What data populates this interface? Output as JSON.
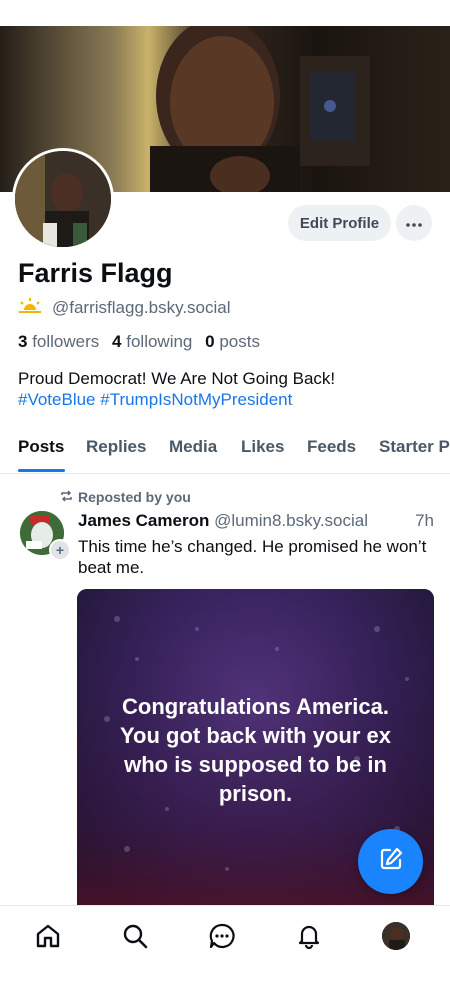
{
  "profile": {
    "display_name": "Farris Flagg",
    "handle": "@farrisflagg.bsky.social",
    "followers_count": "3",
    "followers_label": "followers",
    "following_count": "4",
    "following_label": "following",
    "posts_count": "0",
    "posts_label": "posts",
    "bio_line1": "Proud Democrat! We Are Not Going Back!",
    "bio_tags": "#VoteBlue #TrumpIsNotMyPresident",
    "edit_label": "Edit Profile"
  },
  "tabs": [
    {
      "label": "Posts"
    },
    {
      "label": "Replies"
    },
    {
      "label": "Media"
    },
    {
      "label": "Likes"
    },
    {
      "label": "Feeds"
    },
    {
      "label": "Starter P"
    }
  ],
  "feed": {
    "post": {
      "repost_label": "Reposted by you",
      "author_name": "James Cameron",
      "author_handle": "@lumin8.bsky.social",
      "time": "7h",
      "text": "This time he’s changed. He promised he won’t beat me.",
      "image_text_line1": "Congratulations America.",
      "image_text_line2": "You got back with your ex",
      "image_text_line3": "who is supposed to be in",
      "image_text_line4": "prison."
    }
  },
  "icons": {
    "more": "ellipsis-icon",
    "repost": "repost-icon",
    "compose": "compose-icon",
    "home": "home-icon",
    "search": "search-icon",
    "chat": "chat-icon",
    "notifications": "bell-icon",
    "sun": "sunrise-icon"
  },
  "colors": {
    "accent": "#1777e8",
    "fab": "#1a84ff",
    "muted": "#5b6978"
  }
}
